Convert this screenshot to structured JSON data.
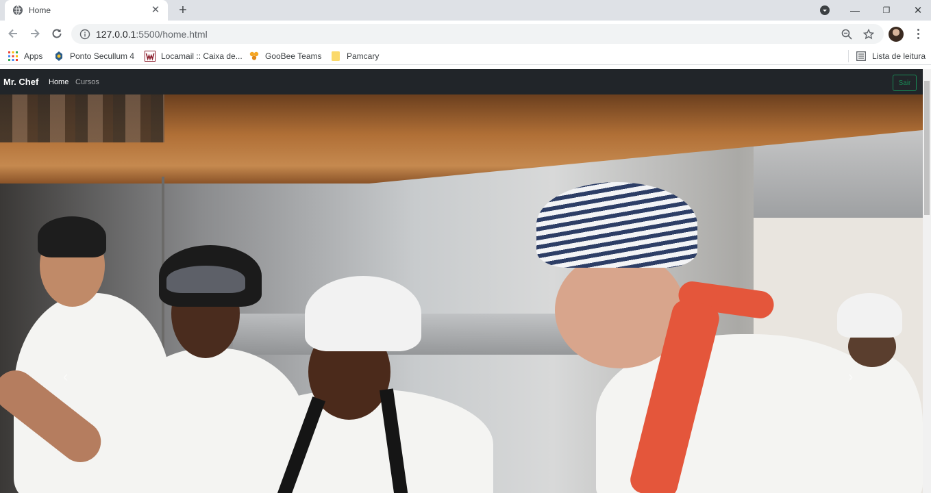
{
  "browser": {
    "tab": {
      "title": "Home"
    },
    "url": {
      "host": "127.0.0.1",
      "path": ":5500/home.html"
    },
    "bookmarks": [
      {
        "label": "Apps",
        "icon": "apps-grid-icon"
      },
      {
        "label": "Ponto Secullum 4",
        "icon": "secullum-icon"
      },
      {
        "label": "Locamail :: Caixa de...",
        "icon": "locamail-icon"
      },
      {
        "label": "GooBee Teams",
        "icon": "goobee-icon"
      },
      {
        "label": "Pamcary",
        "icon": "folder-icon"
      }
    ],
    "reading_list": "Lista de leitura"
  },
  "navbar": {
    "brand": "Mr. Chef",
    "links": [
      "Home",
      "Cursos"
    ],
    "logout": "Sair",
    "colors": {
      "background": "#212529",
      "logout": "#198754"
    }
  },
  "carousel": {
    "prev_icon": "chevron-left-icon",
    "next_icon": "chevron-right-icon"
  }
}
